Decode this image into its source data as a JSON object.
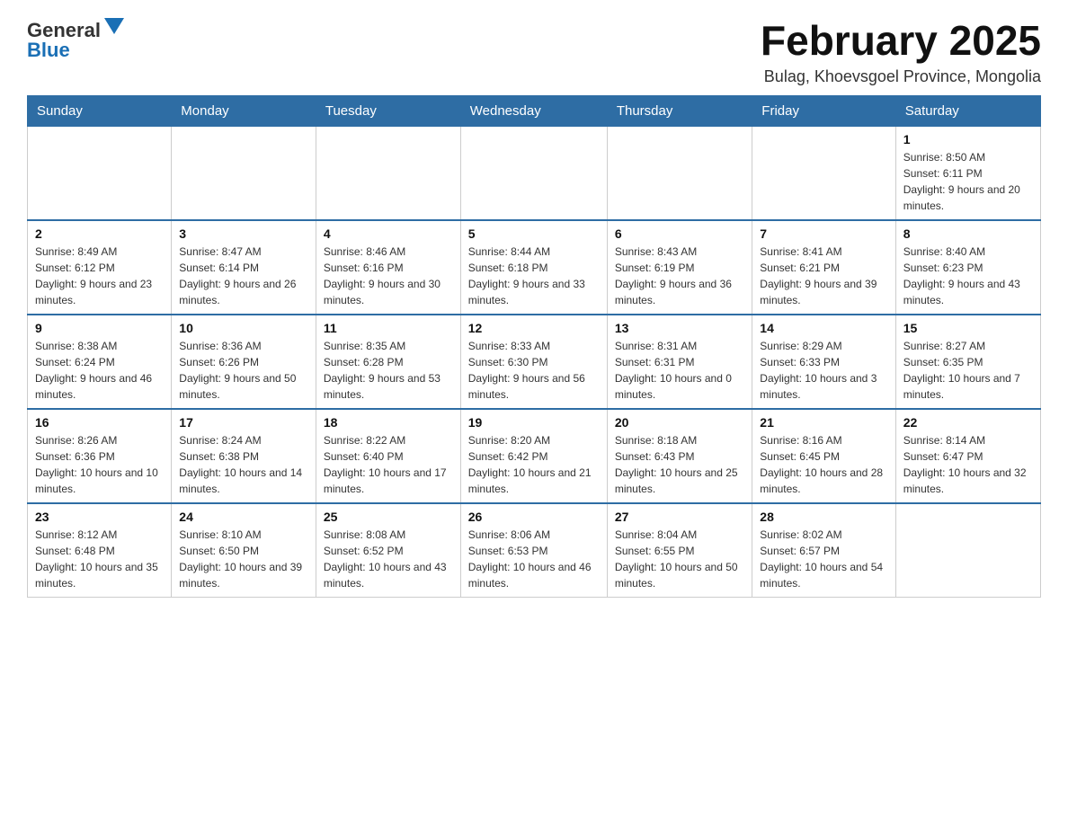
{
  "header": {
    "logo": {
      "general": "General",
      "blue": "Blue"
    },
    "title": "February 2025",
    "location": "Bulag, Khoevsgoel Province, Mongolia"
  },
  "days_of_week": [
    "Sunday",
    "Monday",
    "Tuesday",
    "Wednesday",
    "Thursday",
    "Friday",
    "Saturday"
  ],
  "weeks": [
    {
      "days": [
        {
          "num": "",
          "sunrise": "",
          "sunset": "",
          "daylight": ""
        },
        {
          "num": "",
          "sunrise": "",
          "sunset": "",
          "daylight": ""
        },
        {
          "num": "",
          "sunrise": "",
          "sunset": "",
          "daylight": ""
        },
        {
          "num": "",
          "sunrise": "",
          "sunset": "",
          "daylight": ""
        },
        {
          "num": "",
          "sunrise": "",
          "sunset": "",
          "daylight": ""
        },
        {
          "num": "",
          "sunrise": "",
          "sunset": "",
          "daylight": ""
        },
        {
          "num": "1",
          "sunrise": "Sunrise: 8:50 AM",
          "sunset": "Sunset: 6:11 PM",
          "daylight": "Daylight: 9 hours and 20 minutes."
        }
      ]
    },
    {
      "days": [
        {
          "num": "2",
          "sunrise": "Sunrise: 8:49 AM",
          "sunset": "Sunset: 6:12 PM",
          "daylight": "Daylight: 9 hours and 23 minutes."
        },
        {
          "num": "3",
          "sunrise": "Sunrise: 8:47 AM",
          "sunset": "Sunset: 6:14 PM",
          "daylight": "Daylight: 9 hours and 26 minutes."
        },
        {
          "num": "4",
          "sunrise": "Sunrise: 8:46 AM",
          "sunset": "Sunset: 6:16 PM",
          "daylight": "Daylight: 9 hours and 30 minutes."
        },
        {
          "num": "5",
          "sunrise": "Sunrise: 8:44 AM",
          "sunset": "Sunset: 6:18 PM",
          "daylight": "Daylight: 9 hours and 33 minutes."
        },
        {
          "num": "6",
          "sunrise": "Sunrise: 8:43 AM",
          "sunset": "Sunset: 6:19 PM",
          "daylight": "Daylight: 9 hours and 36 minutes."
        },
        {
          "num": "7",
          "sunrise": "Sunrise: 8:41 AM",
          "sunset": "Sunset: 6:21 PM",
          "daylight": "Daylight: 9 hours and 39 minutes."
        },
        {
          "num": "8",
          "sunrise": "Sunrise: 8:40 AM",
          "sunset": "Sunset: 6:23 PM",
          "daylight": "Daylight: 9 hours and 43 minutes."
        }
      ]
    },
    {
      "days": [
        {
          "num": "9",
          "sunrise": "Sunrise: 8:38 AM",
          "sunset": "Sunset: 6:24 PM",
          "daylight": "Daylight: 9 hours and 46 minutes."
        },
        {
          "num": "10",
          "sunrise": "Sunrise: 8:36 AM",
          "sunset": "Sunset: 6:26 PM",
          "daylight": "Daylight: 9 hours and 50 minutes."
        },
        {
          "num": "11",
          "sunrise": "Sunrise: 8:35 AM",
          "sunset": "Sunset: 6:28 PM",
          "daylight": "Daylight: 9 hours and 53 minutes."
        },
        {
          "num": "12",
          "sunrise": "Sunrise: 8:33 AM",
          "sunset": "Sunset: 6:30 PM",
          "daylight": "Daylight: 9 hours and 56 minutes."
        },
        {
          "num": "13",
          "sunrise": "Sunrise: 8:31 AM",
          "sunset": "Sunset: 6:31 PM",
          "daylight": "Daylight: 10 hours and 0 minutes."
        },
        {
          "num": "14",
          "sunrise": "Sunrise: 8:29 AM",
          "sunset": "Sunset: 6:33 PM",
          "daylight": "Daylight: 10 hours and 3 minutes."
        },
        {
          "num": "15",
          "sunrise": "Sunrise: 8:27 AM",
          "sunset": "Sunset: 6:35 PM",
          "daylight": "Daylight: 10 hours and 7 minutes."
        }
      ]
    },
    {
      "days": [
        {
          "num": "16",
          "sunrise": "Sunrise: 8:26 AM",
          "sunset": "Sunset: 6:36 PM",
          "daylight": "Daylight: 10 hours and 10 minutes."
        },
        {
          "num": "17",
          "sunrise": "Sunrise: 8:24 AM",
          "sunset": "Sunset: 6:38 PM",
          "daylight": "Daylight: 10 hours and 14 minutes."
        },
        {
          "num": "18",
          "sunrise": "Sunrise: 8:22 AM",
          "sunset": "Sunset: 6:40 PM",
          "daylight": "Daylight: 10 hours and 17 minutes."
        },
        {
          "num": "19",
          "sunrise": "Sunrise: 8:20 AM",
          "sunset": "Sunset: 6:42 PM",
          "daylight": "Daylight: 10 hours and 21 minutes."
        },
        {
          "num": "20",
          "sunrise": "Sunrise: 8:18 AM",
          "sunset": "Sunset: 6:43 PM",
          "daylight": "Daylight: 10 hours and 25 minutes."
        },
        {
          "num": "21",
          "sunrise": "Sunrise: 8:16 AM",
          "sunset": "Sunset: 6:45 PM",
          "daylight": "Daylight: 10 hours and 28 minutes."
        },
        {
          "num": "22",
          "sunrise": "Sunrise: 8:14 AM",
          "sunset": "Sunset: 6:47 PM",
          "daylight": "Daylight: 10 hours and 32 minutes."
        }
      ]
    },
    {
      "days": [
        {
          "num": "23",
          "sunrise": "Sunrise: 8:12 AM",
          "sunset": "Sunset: 6:48 PM",
          "daylight": "Daylight: 10 hours and 35 minutes."
        },
        {
          "num": "24",
          "sunrise": "Sunrise: 8:10 AM",
          "sunset": "Sunset: 6:50 PM",
          "daylight": "Daylight: 10 hours and 39 minutes."
        },
        {
          "num": "25",
          "sunrise": "Sunrise: 8:08 AM",
          "sunset": "Sunset: 6:52 PM",
          "daylight": "Daylight: 10 hours and 43 minutes."
        },
        {
          "num": "26",
          "sunrise": "Sunrise: 8:06 AM",
          "sunset": "Sunset: 6:53 PM",
          "daylight": "Daylight: 10 hours and 46 minutes."
        },
        {
          "num": "27",
          "sunrise": "Sunrise: 8:04 AM",
          "sunset": "Sunset: 6:55 PM",
          "daylight": "Daylight: 10 hours and 50 minutes."
        },
        {
          "num": "28",
          "sunrise": "Sunrise: 8:02 AM",
          "sunset": "Sunset: 6:57 PM",
          "daylight": "Daylight: 10 hours and 54 minutes."
        },
        {
          "num": "",
          "sunrise": "",
          "sunset": "",
          "daylight": ""
        }
      ]
    }
  ]
}
